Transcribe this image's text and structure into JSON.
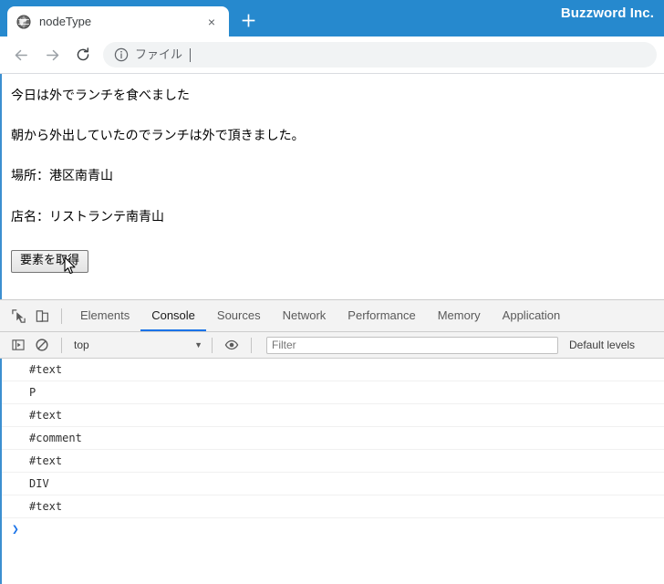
{
  "window": {
    "brand": "Buzzword Inc."
  },
  "tabs": [
    {
      "title": "nodeType",
      "favicon": "globe-icon",
      "close_label": "×"
    }
  ],
  "newtab": {
    "label": "+"
  },
  "toolbar": {
    "back_icon": "back-arrow-icon",
    "forward_icon": "forward-arrow-icon",
    "reload_icon": "reload-icon",
    "omnibox": {
      "info_icon": "info-circle-icon",
      "text": "ファイル"
    }
  },
  "page": {
    "paragraphs": [
      "今日は外でランチを食べました",
      "朝から外出していたのでランチは外で頂きました。",
      "場所：港区南青山",
      "店名：リストランテ南青山"
    ],
    "button_label": "要素を取得"
  },
  "devtools": {
    "inspect_icon": "inspect-element-icon",
    "device_icon": "device-toolbar-icon",
    "tabs": [
      {
        "label": "Elements",
        "active": false
      },
      {
        "label": "Console",
        "active": true
      },
      {
        "label": "Sources",
        "active": false
      },
      {
        "label": "Network",
        "active": false
      },
      {
        "label": "Performance",
        "active": false
      },
      {
        "label": "Memory",
        "active": false
      },
      {
        "label": "Application",
        "active": false
      }
    ],
    "console_toolbar": {
      "sidebar_icon": "show-console-sidebar-icon",
      "clear_icon": "clear-console-icon",
      "context_value": "top",
      "context_arrow": "▼",
      "eye_icon": "live-expression-eye-icon",
      "filter_placeholder": "Filter",
      "filter_value": "",
      "levels_label": "Default levels"
    },
    "console_output": [
      "#text",
      "P",
      "#text",
      "#comment",
      "#text",
      "DIV",
      "#text"
    ],
    "prompt_symbol": "❯"
  },
  "colors": {
    "titlebar_blue": "#2689ce",
    "accent_blue": "#1a73e8",
    "viewport_border": "#3c8fd0"
  }
}
